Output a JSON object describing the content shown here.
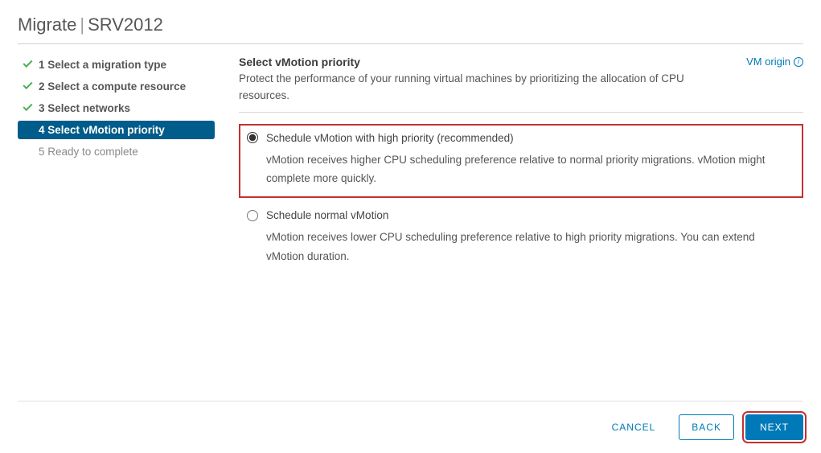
{
  "header": {
    "wizard_name": "Migrate",
    "target": "SRV2012"
  },
  "sidebar": {
    "steps": [
      {
        "label": "1 Select a migration type"
      },
      {
        "label": "2 Select a compute resource"
      },
      {
        "label": "3 Select networks"
      },
      {
        "label": "4 Select vMotion priority"
      },
      {
        "label": "5 Ready to complete"
      }
    ]
  },
  "main": {
    "title": "Select vMotion priority",
    "subtitle": "Protect the performance of your running virtual machines by prioritizing the allocation of CPU resources.",
    "vm_origin": "VM origin"
  },
  "options": [
    {
      "label": "Schedule vMotion with high priority (recommended)",
      "description": "vMotion receives higher CPU scheduling preference relative to normal priority migrations. vMotion might complete more quickly.",
      "selected": true
    },
    {
      "label": "Schedule normal vMotion",
      "description": "vMotion receives lower CPU scheduling preference relative to high priority migrations. You can extend vMotion duration.",
      "selected": false
    }
  ],
  "footer": {
    "cancel": "CANCEL",
    "back": "BACK",
    "next": "NEXT"
  }
}
